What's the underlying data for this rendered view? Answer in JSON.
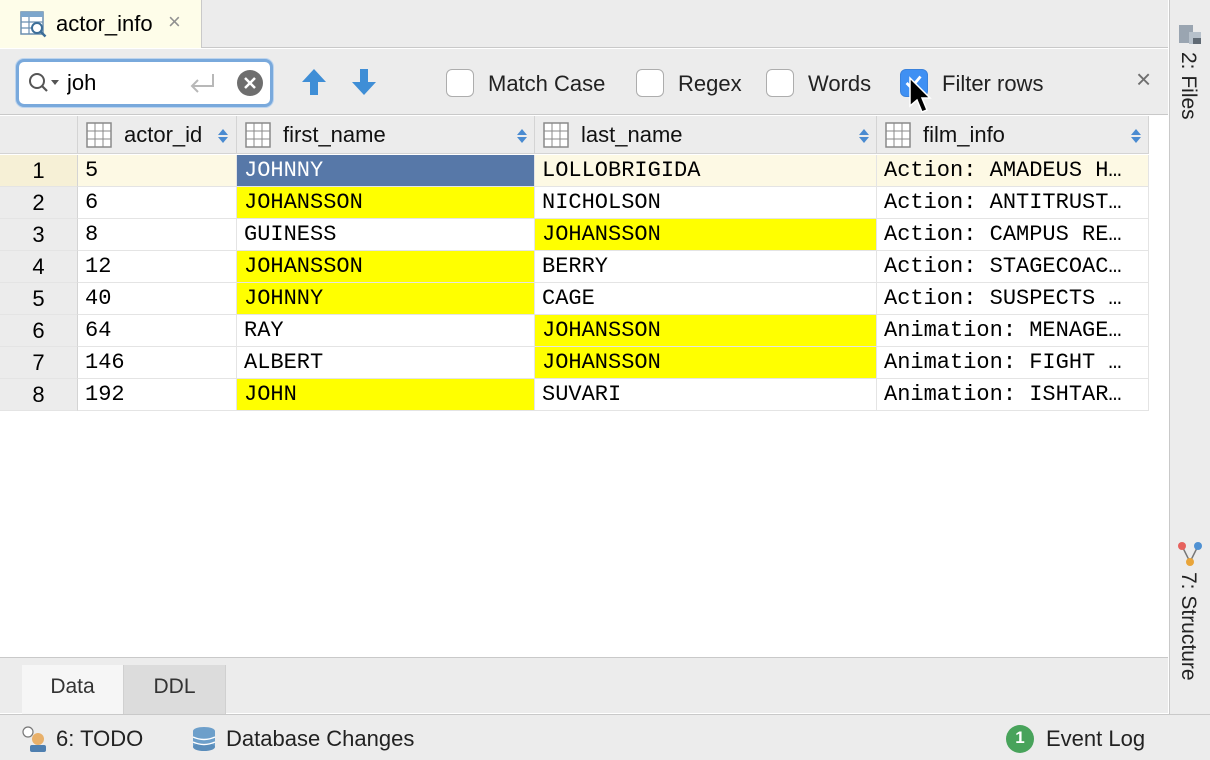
{
  "editor_tab": {
    "label": "actor_info",
    "close": "×",
    "icon": "table-editor-icon"
  },
  "findbar": {
    "search_value": "joh",
    "search_placeholder": "",
    "options": [
      {
        "label": "Match Case",
        "checked": false
      },
      {
        "label": "Regex",
        "checked": false
      },
      {
        "label": "Words",
        "checked": false
      },
      {
        "label": "Filter rows",
        "checked": true
      }
    ],
    "close": "×"
  },
  "grid": {
    "columns": [
      {
        "name": "actor_id"
      },
      {
        "name": "first_name"
      },
      {
        "name": "last_name"
      },
      {
        "name": "film_info"
      }
    ],
    "rows": [
      {
        "num": "1",
        "cells": [
          "5",
          "JOHNNY",
          "LOLLOBRIGIDA",
          "Action: AMADEUS H…"
        ]
      },
      {
        "num": "2",
        "cells": [
          "6",
          "JOHANSSON",
          "NICHOLSON",
          "Action: ANTITRUST…"
        ]
      },
      {
        "num": "3",
        "cells": [
          "8",
          "GUINESS",
          "JOHANSSON",
          "Action: CAMPUS RE…"
        ]
      },
      {
        "num": "4",
        "cells": [
          "12",
          "JOHANSSON",
          "BERRY",
          "Action: STAGECOAC…"
        ]
      },
      {
        "num": "5",
        "cells": [
          "40",
          "JOHNNY",
          "CAGE",
          "Action: SUSPECTS …"
        ]
      },
      {
        "num": "6",
        "cells": [
          "64",
          "RAY",
          "JOHANSSON",
          "Animation: MENAGE…"
        ]
      },
      {
        "num": "7",
        "cells": [
          "146",
          "ALBERT",
          "JOHANSSON",
          "Animation: FIGHT …"
        ]
      },
      {
        "num": "8",
        "cells": [
          "192",
          "JOHN",
          "SUVARI",
          "Animation: ISHTAR…"
        ]
      }
    ],
    "highlight_color": "#ffff00",
    "selection_color": "#5778a8"
  },
  "bottom_tabs": [
    {
      "label": "Data",
      "active": true
    },
    {
      "label": "DDL",
      "active": false
    }
  ],
  "statusbar": {
    "todo": "6: TODO",
    "db_changes": "Database Changes",
    "event_log": "Event Log",
    "event_count": "1"
  },
  "right_strip": {
    "files": "2: Files",
    "structure": "7: Structure"
  }
}
